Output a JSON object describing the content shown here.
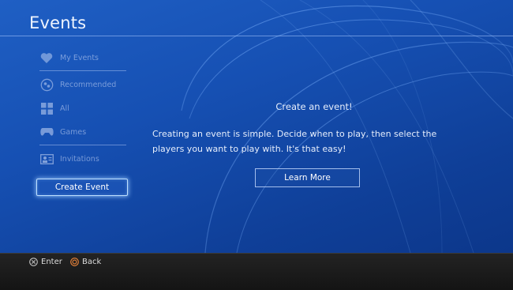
{
  "header": {
    "title": "Events"
  },
  "menu": {
    "items": [
      {
        "label": "My Events",
        "icon": "heart-icon"
      },
      {
        "label": "Recommended",
        "icon": "recommended-icon"
      },
      {
        "label": "All",
        "icon": "grid-icon"
      },
      {
        "label": "Games",
        "icon": "controller-icon"
      },
      {
        "label": "Invitations",
        "icon": "invitation-icon"
      }
    ],
    "create_label": "Create Event"
  },
  "main": {
    "heading": "Create an event!",
    "description": "Creating an event is simple. Decide when to play, then select the players you want to play with. It's that easy!",
    "learn_more_label": "Learn More"
  },
  "footer": {
    "enter_label": "Enter",
    "enter_icon": "cross-button-icon",
    "back_label": "Back",
    "back_icon": "circle-button-icon",
    "back_color": "#e8833a"
  }
}
